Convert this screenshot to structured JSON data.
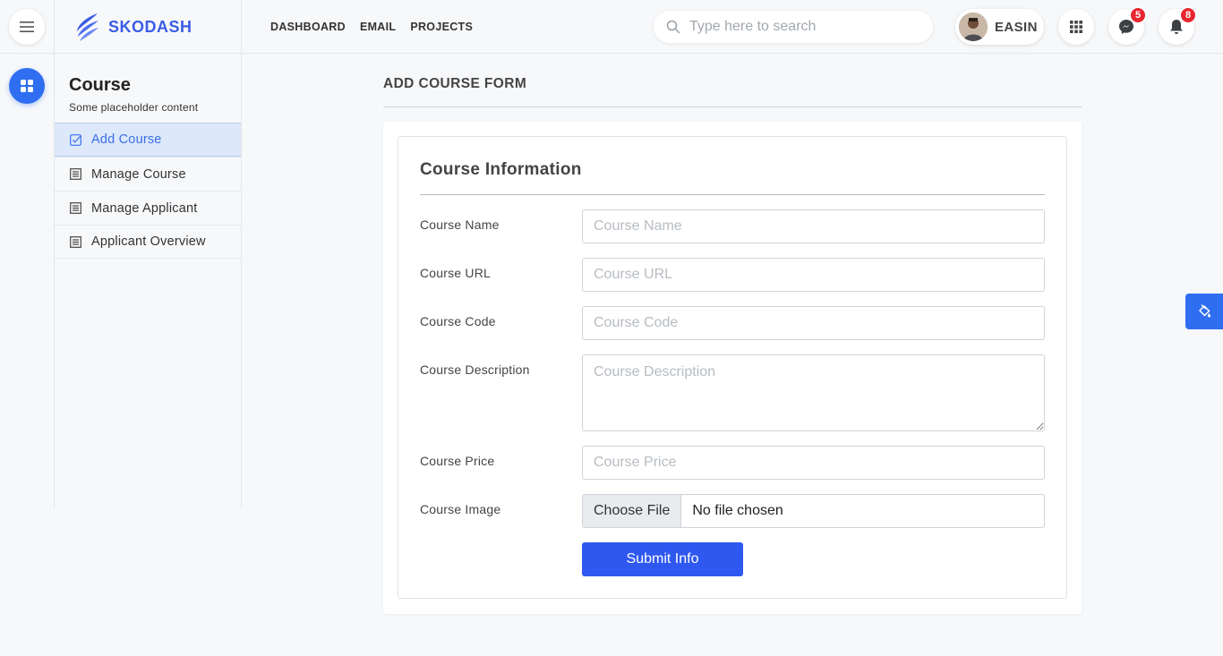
{
  "header": {
    "brand": "SKODASH",
    "nav": [
      "DASHBOARD",
      "EMAIL",
      "PROJECTS"
    ],
    "search_placeholder": "Type here to search",
    "user_name": "EASIN",
    "messages_count": "5",
    "notifications_count": "8"
  },
  "sidebar": {
    "title": "Course",
    "subtitle": "Some placeholder content",
    "items": [
      {
        "label": "Add Course",
        "icon": "check-square-icon"
      },
      {
        "label": "Manage Course",
        "icon": "list-icon"
      },
      {
        "label": "Manage Applicant",
        "icon": "list-icon"
      },
      {
        "label": "Applicant Overview",
        "icon": "list-icon"
      }
    ]
  },
  "main": {
    "page_title": "ADD COURSE FORM",
    "section_title": "Course Information",
    "fields": [
      {
        "label": "Course Name",
        "placeholder": "Course Name"
      },
      {
        "label": "Course URL",
        "placeholder": "Course URL"
      },
      {
        "label": "Course Code",
        "placeholder": "Course Code"
      },
      {
        "label": "Course Description",
        "placeholder": "Course Description"
      },
      {
        "label": "Course Price",
        "placeholder": "Course Price"
      }
    ],
    "image_field": {
      "label": "Course Image",
      "button": "Choose File",
      "status": "No file chosen"
    },
    "submit_label": "Submit Info"
  },
  "colors": {
    "accent": "#2f58f0",
    "brand": "#3a5ce5",
    "badge": "#e8262f",
    "active_bg": "#dde8fb"
  }
}
